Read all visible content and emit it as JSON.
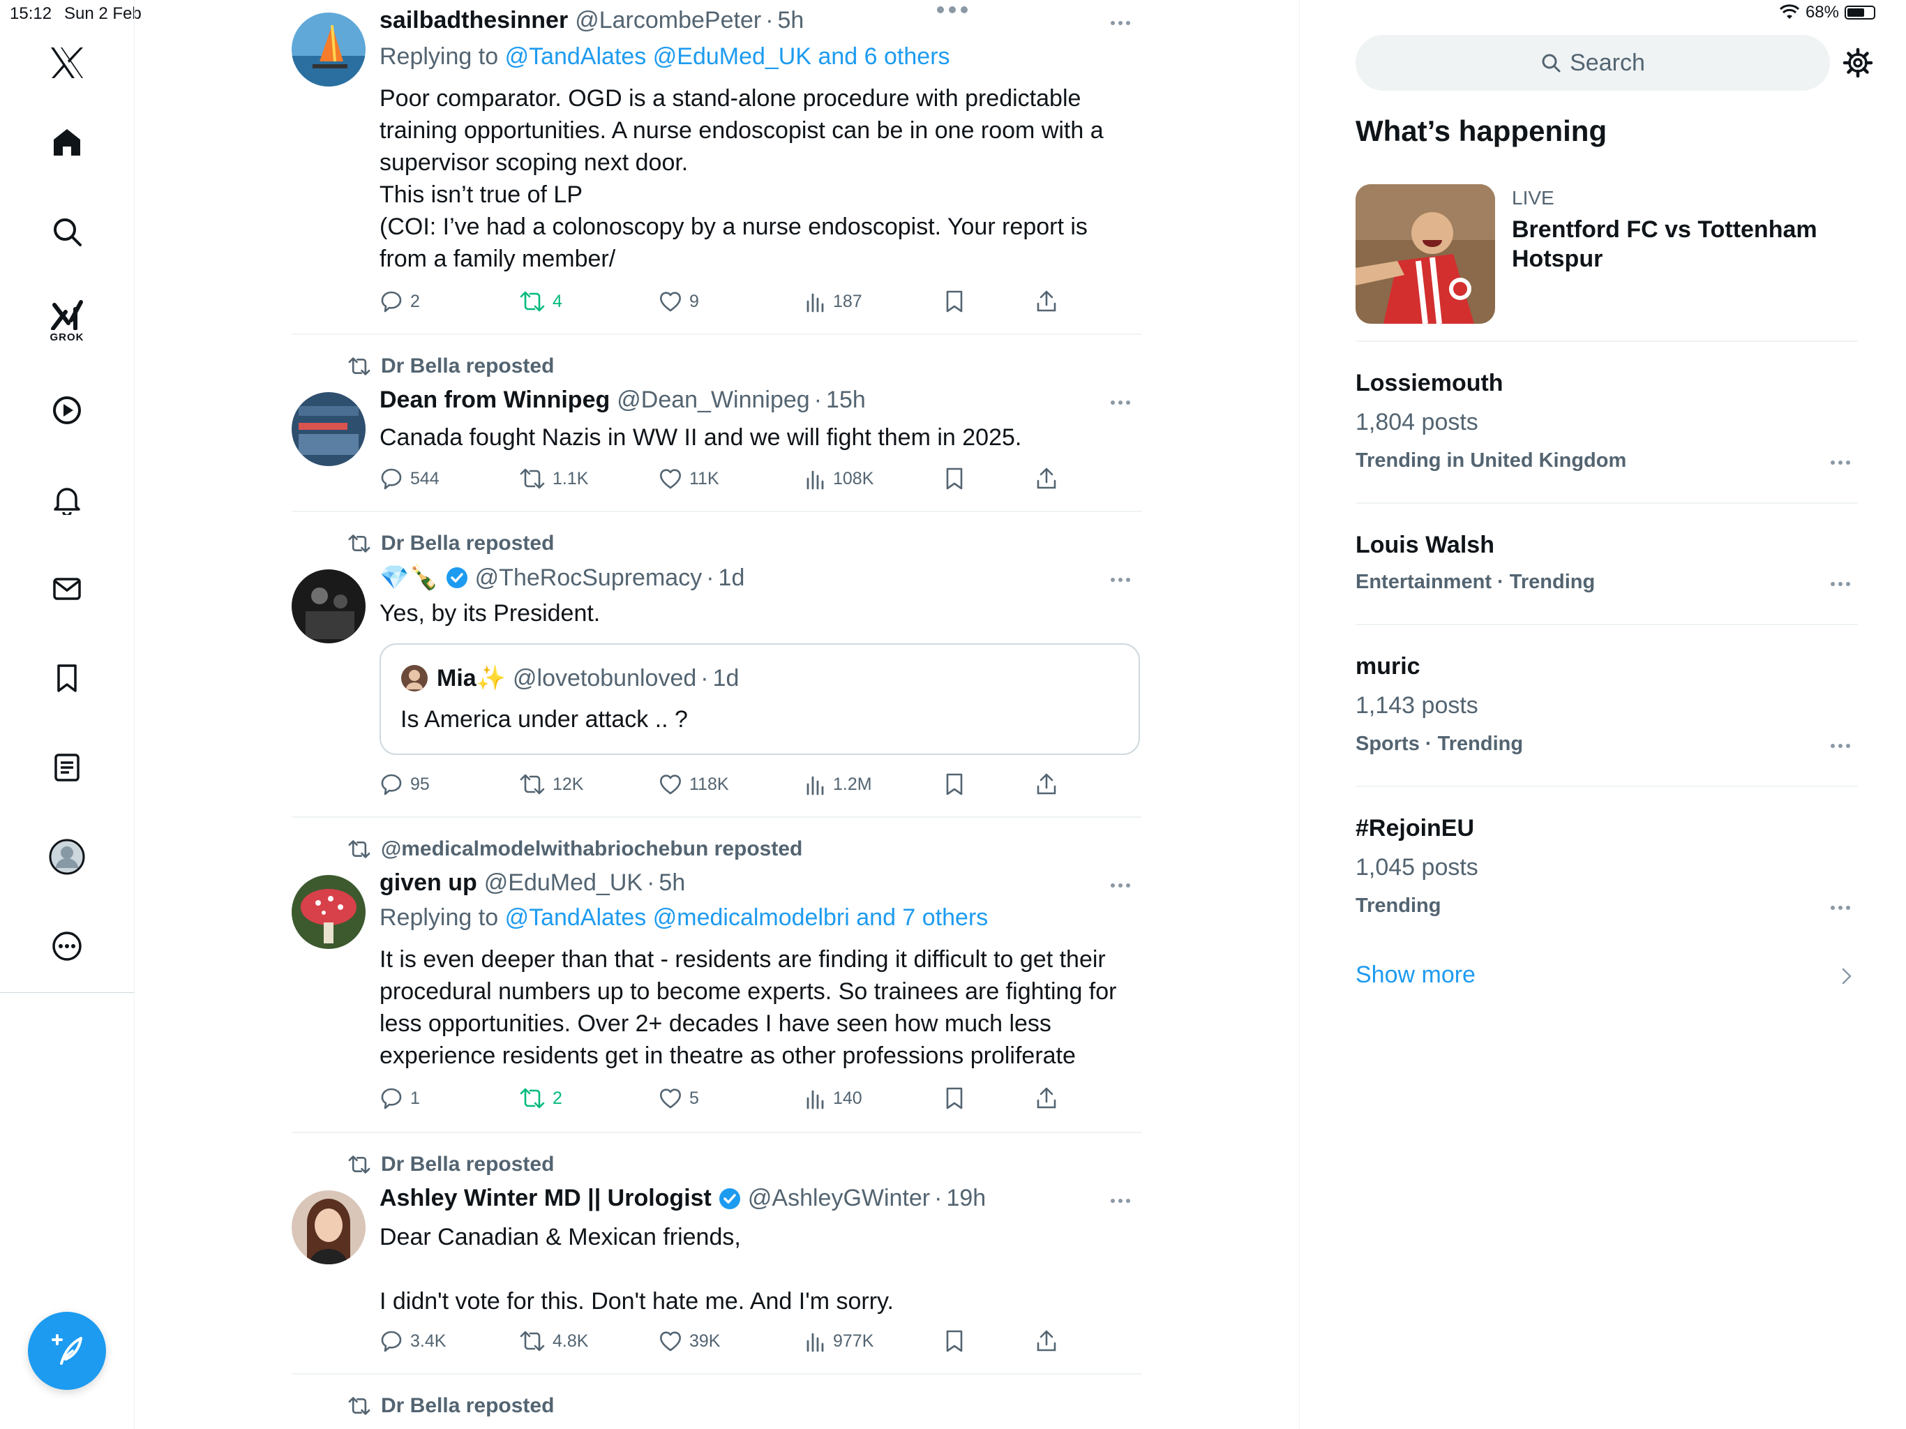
{
  "status_bar": {
    "time": "15:12",
    "date": "Sun 2 Feb",
    "battery": "68%",
    "battery_level": 0.68
  },
  "nav": {
    "items": [
      "x-logo-icon",
      "home-icon",
      "search-icon",
      "grok-icon",
      "video-icon",
      "notifications-icon",
      "messages-icon",
      "bookmarks-icon",
      "lists-icon",
      "profile-icon",
      "more-icon"
    ],
    "grok_label": "GROK",
    "compose_icon": "feather-plus-icon"
  },
  "timeline": {
    "tweets": [
      {
        "display_name": "sailbadthesinner",
        "handle": "@LarcombePeter",
        "time": "5h",
        "reply_prefix": "Replying to",
        "reply_users": "@TandAlates @EduMed_UK and 6 others",
        "text_lines": [
          "Poor comparator. OGD is a stand-alone procedure with predictable",
          "training opportunities. A nurse endoscopist can be in one room with a",
          "supervisor scoping next door.",
          "This isn’t true of LP",
          "(COI: I’ve had a colonoscopy by a nurse endoscopist. Your report is",
          "from a family member/"
        ],
        "replies": "2",
        "reposts": "4",
        "likes": "9",
        "views": "187"
      },
      {
        "reposted_by": "Dr Bella reposted",
        "display_name": "Dean from Winnipeg",
        "handle": "@Dean_Winnipeg",
        "time": "15h",
        "text": "Canada fought Nazis in WW II and  we will fight them in 2025.",
        "replies": "544",
        "reposts": "1.1K",
        "likes": "11K",
        "views": "108K"
      },
      {
        "reposted_by": "Dr Bella reposted",
        "display_name": "💎🍾",
        "handle": "@TheRocSupremacy",
        "time": "1d",
        "text": "Yes, by its President.",
        "quote": {
          "display_name": "Mia",
          "emoji": "✨",
          "handle": "@lovetobunloved",
          "time": "1d",
          "text": "Is America under attack .. ?"
        },
        "replies": "95",
        "reposts": "12K",
        "likes": "118K",
        "views": "1.2M"
      },
      {
        "reposted_by": "@medicalmodelwithabriochebun reposted",
        "display_name": "given up",
        "handle": "@EduMed_UK",
        "time": "5h",
        "reply_prefix": "Replying to",
        "reply_users": "@TandAlates @medicalmodelbri and 7 others",
        "text_lines": [
          "It is even deeper than that - residents are finding it difficult to get their",
          "procedural numbers up to become experts. So trainees are fighting for",
          "less opportunities. Over 2+ decades I have seen how much less",
          "experience residents get in theatre as other professions proliferate"
        ],
        "replies": "1",
        "reposts": "2",
        "likes": "5",
        "views": "140"
      },
      {
        "reposted_by": "Dr Bella reposted",
        "display_name": "Ashley Winter MD || Urologist",
        "handle": "@AshleyGWinter",
        "time": "19h",
        "text_lines": [
          "Dear Canadian & Mexican friends,",
          "",
          "I didn't vote for this. Don't hate me. And I'm sorry."
        ],
        "replies": "3.4K",
        "reposts": "4.8K",
        "likes": "39K",
        "views": "977K"
      },
      {
        "reposted_by": "Dr Bella reposted"
      }
    ],
    "separator": "·"
  },
  "sidebar": {
    "search_placeholder": "Search",
    "section_title": "What’s happening",
    "live": {
      "label": "LIVE",
      "title": "Brentford FC vs Tottenham Hotspur"
    },
    "trends": [
      {
        "name": "Lossiemouth",
        "count": "1,804 posts",
        "meta": "Trending in United Kingdom"
      },
      {
        "name": "Louis Walsh",
        "meta": "Entertainment · Trending"
      },
      {
        "name": "muric",
        "count": "1,143 posts",
        "meta": "Sports · Trending"
      },
      {
        "name": "#RejoinEU",
        "count": "1,045 posts",
        "meta": "Trending"
      }
    ],
    "show_more": "Show more"
  },
  "colors": {
    "accent": "#1d9bf0",
    "repost_active": "#00ba7c",
    "secondary_text": "#536471",
    "divider": "#eff3f4"
  }
}
